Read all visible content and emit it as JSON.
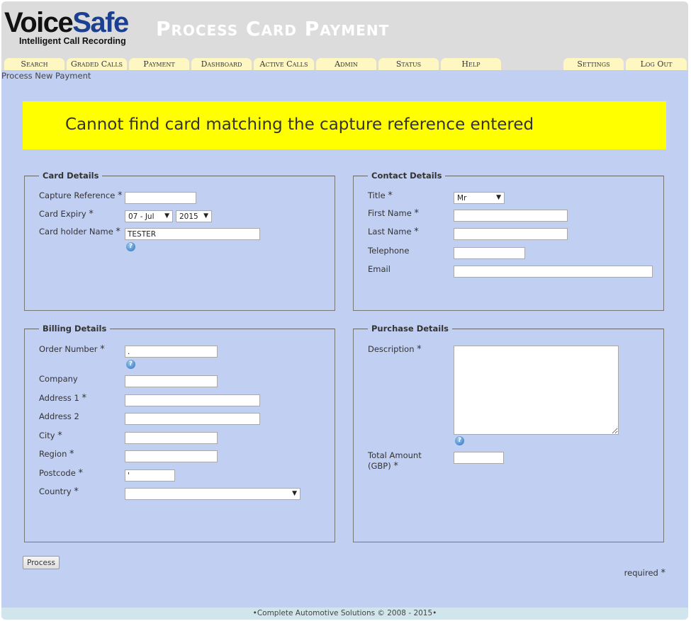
{
  "header": {
    "logo_voice": "Voice",
    "logo_safe": "Safe",
    "logo_tagline": "Intelligent Call Recording",
    "page_title": "Process Card Payment"
  },
  "nav": {
    "tabs": [
      {
        "label": "Search"
      },
      {
        "label": "Graded Calls"
      },
      {
        "label": "Payment"
      },
      {
        "label": "Dashboard"
      },
      {
        "label": "Active Calls"
      },
      {
        "label": "Admin"
      },
      {
        "label": "Status"
      },
      {
        "label": "Help"
      }
    ],
    "right_tabs": [
      {
        "label": "Settings"
      },
      {
        "label": "Log Out"
      }
    ]
  },
  "breadcrumb": "Process New Payment",
  "alert_message": "Cannot find card matching the capture reference entered",
  "card_details": {
    "legend": "Card Details",
    "capture_reference_label": "Capture Reference",
    "capture_reference_value": "",
    "card_expiry_label": "Card Expiry",
    "expiry_month": "07 - Jul",
    "expiry_year": "2015",
    "card_holder_label": "Card holder Name",
    "card_holder_value": "TESTER"
  },
  "contact_details": {
    "legend": "Contact Details",
    "title_label": "Title",
    "title_value": "Mr",
    "first_name_label": "First Name",
    "first_name_value": "",
    "last_name_label": "Last Name",
    "last_name_value": "",
    "telephone_label": "Telephone",
    "telephone_value": "",
    "email_label": "Email",
    "email_value": ""
  },
  "billing_details": {
    "legend": "Billing Details",
    "order_number_label": "Order Number",
    "order_number_value": ".",
    "company_label": "Company",
    "company_value": "",
    "address1_label": "Address 1",
    "address1_value": "",
    "address2_label": "Address 2",
    "address2_value": "",
    "city_label": "City",
    "city_value": "",
    "region_label": "Region",
    "region_value": "",
    "postcode_label": "Postcode",
    "postcode_value": "'",
    "country_label": "Country",
    "country_value": ""
  },
  "purchase_details": {
    "legend": "Purchase Details",
    "description_label": "Description",
    "description_value": "",
    "total_amount_label_1": "Total Amount",
    "total_amount_label_2": "(GBP)",
    "total_amount_value": ""
  },
  "required_marker": "*",
  "process_button_label": "Process",
  "required_note": "required",
  "footer_text": "•Complete Automotive Solutions © 2008 - 2015•",
  "colors": {
    "content_bg": "#c1cff2",
    "header_bg": "#dcdcdc",
    "tab_bg": "#fff7c2",
    "alert_bg": "#ffff00",
    "logo_accent": "#1d3f8f",
    "footer_bg": "#d1e6ec"
  },
  "icons": {
    "help": "help-icon",
    "dropdown": "chevron-down-icon"
  }
}
